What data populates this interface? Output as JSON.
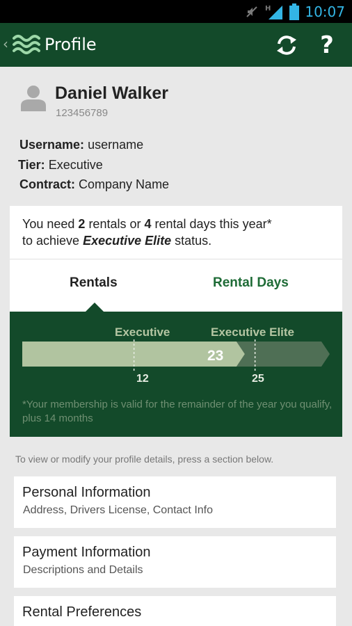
{
  "status_bar": {
    "time": "10:07",
    "network": "H",
    "icons": [
      "mute-icon",
      "signal-icon",
      "battery-icon"
    ]
  },
  "app_bar": {
    "title": "Profile",
    "back_icon": "chevron-left-icon",
    "logo_icon": "wave-logo-icon",
    "actions": [
      "refresh-icon",
      "help-icon"
    ],
    "help_glyph": "?",
    "back_glyph": "‹",
    "color": "#134a2a"
  },
  "profile": {
    "name": "Daniel Walker",
    "member_id": "123456789",
    "username_label": "Username:",
    "username": "username",
    "tier_label": "Tier:",
    "tier": "Executive",
    "contract_label": "Contract:",
    "contract": "Company Name"
  },
  "status_card": {
    "msg_part1": "You need ",
    "rentals_needed": "2",
    "msg_part2": " rentals or ",
    "days_needed": "4",
    "msg_part3": " rental days this year*",
    "msg_part4": "to achieve ",
    "target_tier": "Executive Elite",
    "msg_part5": " status.",
    "tabs": [
      {
        "label": "Rentals",
        "selected": true
      },
      {
        "label": "Rental Days",
        "selected": false
      }
    ],
    "progress": {
      "current": "23",
      "current_value": 23,
      "max_value": 25,
      "tier1_label": "Executive",
      "tier1_threshold": "12",
      "tier2_label": "Executive Elite",
      "tier2_threshold": "25"
    },
    "footnote": "*Your membership is valid for the remainder of the year you qualify, plus 14 months",
    "accent_color": "#1e6b36"
  },
  "instruction": "To view or modify your profile details, press a section below.",
  "sections": [
    {
      "title": "Personal Information",
      "subtitle": "Address, Drivers License, Contact Info"
    },
    {
      "title": "Payment Information",
      "subtitle": "Descriptions and Details"
    },
    {
      "title": "Rental Preferences",
      "subtitle": ""
    }
  ]
}
